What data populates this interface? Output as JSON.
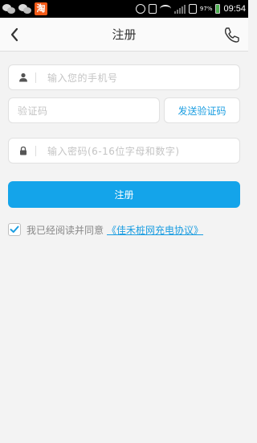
{
  "status_bar": {
    "time": "09:54",
    "battery_percent": "97%",
    "left_icons": [
      "wechat-icon",
      "wechat-icon",
      "taobao-icon"
    ],
    "taobao_glyph": "淘"
  },
  "header": {
    "title": "注册",
    "back_icon": "chevron-left-icon",
    "phone_icon": "phone-icon"
  },
  "form": {
    "phone_placeholder": "输入您的手机号",
    "code_placeholder": "验证码",
    "send_code_label": "发送验证码",
    "password_placeholder": "输入密码(6-16位字母和数字)",
    "register_label": "注册"
  },
  "agreement": {
    "checked": true,
    "text": "我已经阅读并同意",
    "link": "《佳禾桩网充电协议》"
  },
  "colors": {
    "accent": "#14a4ea",
    "link": "#1a9de1",
    "background": "#f3f3f3"
  }
}
